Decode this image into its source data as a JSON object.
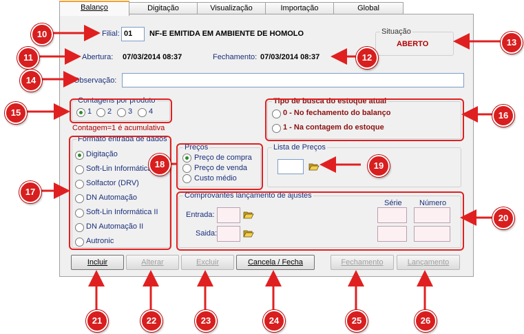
{
  "tabs": [
    "Balanço",
    "Digitação",
    "Visualização",
    "Importação",
    "Global"
  ],
  "header": {
    "filial_label": "Filial:",
    "filial_code": "01",
    "filial_desc": "NF-E EMITIDA EM AMBIENTE DE HOMOLO",
    "abertura_label": "Abertura:",
    "abertura_value": "07/03/2014 08:37",
    "fechamento_label": "Fechamento:",
    "fechamento_value": "07/03/2014 08:37",
    "situacao_label": "Situação",
    "situacao_value": "ABERTO",
    "observacao_label": "Observação:",
    "observacao_value": ""
  },
  "contagens": {
    "title": "Contagens por produto",
    "options": [
      "1",
      "2",
      "3",
      "4"
    ],
    "selected": "1",
    "note": "Contagem=1 é acumulativa"
  },
  "tipo_busca": {
    "title": "Tipo de busca do estoque atual",
    "options": [
      "0 - No fechamento do balanço",
      "1 - Na contagem do estoque"
    ],
    "selected": null
  },
  "formato": {
    "title": "Formato entrada de dados",
    "options": [
      "Digitação",
      "Soft-Lin Informática",
      "Solfactor (DRV)",
      "DN Automação",
      "Soft-Lin Informática II",
      "DN Automação II",
      "Autronic"
    ],
    "selected": "Digitação"
  },
  "precos": {
    "title": "Preços",
    "options": [
      "Preço de compra",
      "Preço de venda",
      "Custo médio"
    ],
    "selected": "Preço de compra"
  },
  "lista_precos": {
    "title": "Lista de Preços",
    "value": ""
  },
  "comprovantes": {
    "title": "Comprovantes lançamento de ajustes",
    "serie_label": "Série",
    "numero_label": "Número",
    "entrada_label": "Entrada:",
    "saida_label": "Saida:"
  },
  "buttons": [
    "Incluir",
    "Alterar",
    "Excluir",
    "Cancela / Fecha",
    "Fechamento",
    "Lançamento"
  ],
  "buttons_enabled": [
    true,
    false,
    false,
    true,
    false,
    false
  ],
  "callouts": [
    "10",
    "11",
    "12",
    "13",
    "14",
    "15",
    "16",
    "17",
    "18",
    "19",
    "20",
    "21",
    "22",
    "23",
    "24",
    "25",
    "26"
  ],
  "colors": {
    "callout": "#d81e1e",
    "highlight": "#e02020",
    "navy_text": "#1a2f7a",
    "tab_accent": "#f0a030"
  },
  "icons": {
    "folder": "folder-open-icon",
    "radio": "radio-button-icon"
  }
}
